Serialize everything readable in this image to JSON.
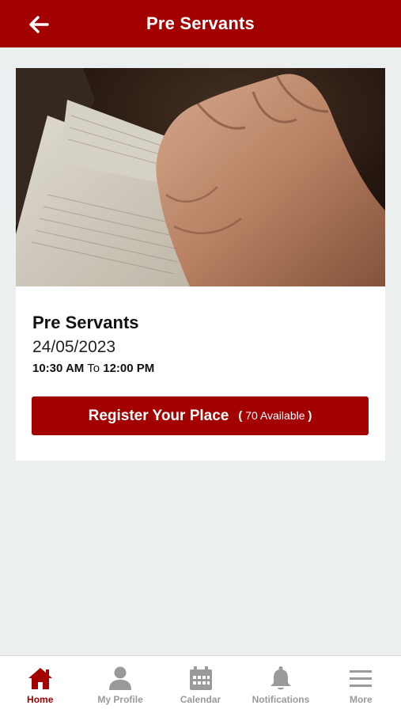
{
  "header": {
    "title": "Pre Servants"
  },
  "event": {
    "name": "Pre Servants",
    "date": "24/05/2023",
    "start_time": "10:30 AM",
    "to_label": "To",
    "end_time": "12:00 PM",
    "hero_image": "praying-hands-on-bible"
  },
  "register": {
    "label": "Register Your Place",
    "open_paren": "(",
    "available": "70 Available",
    "close_paren": ")"
  },
  "tabs": [
    {
      "label": "Home",
      "icon": "home-icon",
      "active": true
    },
    {
      "label": "My Profile",
      "icon": "profile-icon",
      "active": false
    },
    {
      "label": "Calendar",
      "icon": "calendar-icon",
      "active": false
    },
    {
      "label": "Notifications",
      "icon": "bell-icon",
      "active": false
    },
    {
      "label": "More",
      "icon": "menu-icon",
      "active": false
    }
  ],
  "colors": {
    "brand": "#a30000",
    "inactive": "#9a9a9a",
    "background": "#ecefef"
  }
}
